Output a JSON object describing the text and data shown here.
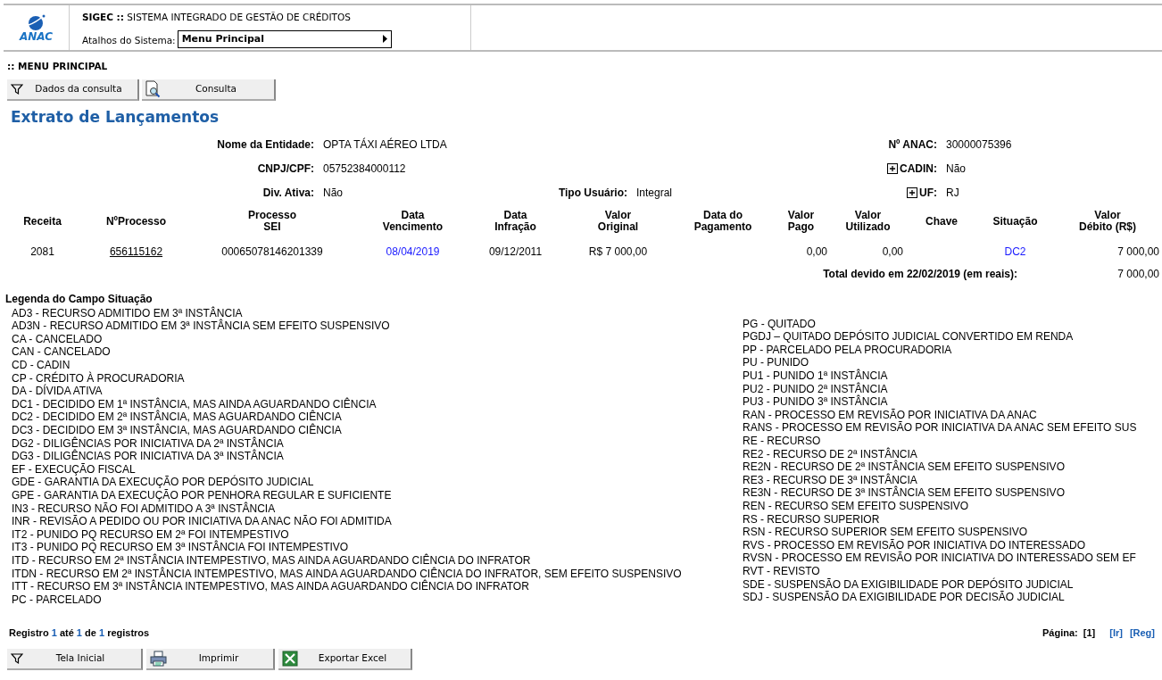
{
  "header": {
    "logo_text": "ANAC",
    "title": "**SIGEC ::** SISTEMA INTEGRADO DE GESTÃO DE CRÉDITOS",
    "shortcut_label": "Atalhos do Sistema:",
    "shortcut_value": "Menu Principal"
  },
  "breadcrumb": ":: MENU PRINCIPAL",
  "toolbar": [
    {
      "label": "Dados da consulta",
      "kind": "filter"
    },
    {
      "label": "Consulta",
      "kind": "search-doc"
    }
  ],
  "page_title": "Extrato de Lançamentos",
  "fields": [
    {
      "left": {
        "label": "Nome da Entidade:",
        "value": "OPTA TÁXI AÉREO LTDA",
        "expandable": false
      },
      "right": {
        "label": "Nº ANAC:",
        "value": "30000075396",
        "expandable": false
      }
    },
    {
      "left": {
        "label": "CNPJ/CPF:",
        "value": "05752384000112",
        "expandable": false
      },
      "right": {
        "label": "CADIN:",
        "value": "Não",
        "expandable": true
      }
    },
    {
      "left": {
        "label": "Div. Ativa:",
        "value": "Não",
        "expandable": false
      },
      "middle": {
        "label": "Tipo Usuário:",
        "value": "Integral",
        "expandable": false
      },
      "right": {
        "label": "UF:",
        "value": "RJ",
        "expandable": true
      }
    }
  ],
  "table": {
    "columns": [
      "Receita",
      "NºProcesso",
      "Processo\nSEI",
      "Data\nVencimento",
      "Data\nInfração",
      "Valor\nOriginal",
      "Data do\nPagamento",
      "Valor\nPago",
      "Valor\nUtilizado",
      "Chave",
      "Situação",
      "Valor\nDébito (R$)"
    ],
    "rows": [
      [
        {
          "text": "2081",
          "kind": "text"
        },
        {
          "text": "656115162",
          "kind": "underlined-link"
        },
        {
          "text": "00065078146201339",
          "kind": "text"
        },
        {
          "text": "08/04/2019",
          "kind": "blue-link"
        },
        {
          "text": "09/12/2011",
          "kind": "text"
        },
        {
          "text": "R$ 7 000,00",
          "kind": "text"
        },
        null,
        {
          "text": "0,00",
          "kind": "text"
        },
        {
          "text": "0,00",
          "kind": "text"
        },
        null,
        {
          "text": "DC2",
          "kind": "blue-link"
        },
        {
          "text": "7 000,00",
          "kind": "text"
        }
      ]
    ],
    "total_label": "Total devido em 22/02/2019 (em reais):",
    "total_value": "7 000,00"
  },
  "legend": {
    "title": "Legenda do Campo Situação",
    "left": [
      "AD3 - RECURSO ADMITIDO EM 3ª INSTÂNCIA",
      "AD3N - RECURSO ADMITIDO EM 3ª INSTÂNCIA SEM EFEITO SUSPENSIVO",
      "CA - CANCELADO",
      "CAN - CANCELADO",
      "CD - CADIN",
      "CP - CRÉDITO À PROCURADORIA",
      "DA - DÍVIDA ATIVA",
      "DC1 - DECIDIDO EM 1ª INSTÂNCIA, MAS AINDA AGUARDANDO CIÊNCIA",
      "DC2 - DECIDIDO EM 2ª INSTÂNCIA, MAS AGUARDANDO CIÊNCIA",
      "DC3 - DECIDIDO EM 3ª INSTÂNCIA, MAS AGUARDANDO CIÊNCIA",
      "DG2 - DILIGÊNCIAS POR INICIATIVA DA 2ª INSTÂNCIA",
      "DG3 - DILIGÊNCIAS POR INICIATIVA DA 3ª INSTÂNCIA",
      "EF - EXECUÇÃO FISCAL",
      "GDE - GARANTIA DA EXECUÇÃO POR DEPÓSITO JUDICIAL",
      "GPE - GARANTIA DA EXECUÇÃO POR PENHORA REGULAR E SUFICIENTE",
      "IN3 - RECURSO NÃO FOI ADMITIDO A 3ª INSTÂNCIA",
      "INR - REVISÃO A PEDIDO OU POR INICIATIVA DA ANAC NÃO FOI ADMITIDA",
      "IT2 - PUNIDO PQ RECURSO EM 2ª FOI INTEMPESTIVO",
      "IT3 - PUNIDO PQ RECURSO EM 3ª INSTÂNCIA FOI INTEMPESTIVO",
      "ITD - RECURSO EM 2ª INSTÂNCIA INTEMPESTIVO, MAS AINDA AGUARDANDO CIÊNCIA DO INFRATOR",
      "ITDN - RECURSO EM 2ª INSTÂNCIA INTEMPESTIVO, MAS AINDA AGUARDANDO CIÊNCIA DO INFRATOR, SEM EFEITO SUSPENSIVO",
      "ITT - RECURSO EM 3ª INSTÂNCIA INTEMPESTIVO, MAS AINDA AGUARDANDO CIÊNCIA DO INFRATOR",
      "PC - PARCELADO"
    ],
    "right": [
      "PG - QUITADO",
      "PGDJ – QUITADO DEPÓSITO JUDICIAL CONVERTIDO EM RENDA",
      "PP - PARCELADO PELA PROCURADORIA",
      "PU - PUNIDO",
      "PU1 - PUNIDO 1ª INSTÂNCIA",
      "PU2 - PUNIDO 2ª INSTÂNCIA",
      "PU3 - PUNIDO 3ª INSTÂNCIA",
      "RAN - PROCESSO EM REVISÃO POR INICIATIVA DA ANAC",
      "RANS - PROCESSO EM REVISÃO POR INICIATIVA DA ANAC SEM EFEITO SUS",
      "RE - RECURSO",
      "RE2 - RECURSO DE 2ª INSTÂNCIA",
      "RE2N - RECURSO DE 2ª INSTÂNCIA SEM EFEITO SUSPENSIVO",
      "RE3 - RECURSO DE 3ª INSTÂNCIA",
      "RE3N - RECURSO DE 3ª INSTÂNCIA SEM EFEITO SUSPENSIVO",
      "REN - RECURSO SEM EFEITO SUSPENSIVO",
      "RS - RECURSO SUPERIOR",
      "RSN - RECURSO SUPERIOR SEM EFEITO SUSPENSIVO",
      "RVS - PROCESSO EM REVISÃO POR INICIATIVA DO INTERESSADO",
      "RVSN - PROCESSO EM REVISÃO POR INICIATIVA DO INTERESSADO SEM EF",
      "RVT - REVISTO",
      "SDE - SUSPENSÃO DA EXIGIBILIDADE POR DEPÓSITO JUDICIAL",
      "SDJ - SUSPENSÃO DA EXIGIBILIDADE POR DECISÃO JUDICIAL"
    ]
  },
  "records": [
    {
      "text": "Registro",
      "highlight": false
    },
    {
      "text": "1",
      "highlight": true
    },
    {
      "text": "até",
      "highlight": false
    },
    {
      "text": "1",
      "highlight": true
    },
    {
      "text": "de",
      "highlight": false
    },
    {
      "text": "1",
      "highlight": true
    },
    {
      "text": "registros",
      "highlight": false
    }
  ],
  "pagination": {
    "label": "Página:",
    "current": "[1]",
    "links": [
      "[Ir]",
      "[Reg]"
    ]
  },
  "bottom_buttons": [
    {
      "label": "Tela Inicial",
      "kind": "filter"
    },
    {
      "label": "Imprimir",
      "kind": "printer"
    },
    {
      "label": "Exportar Excel",
      "kind": "excel"
    }
  ]
}
